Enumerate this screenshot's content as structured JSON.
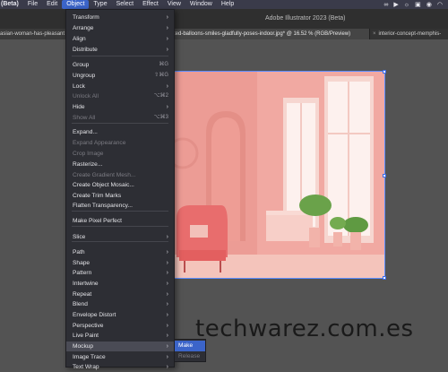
{
  "menubar": {
    "items": [
      {
        "label": "(Beta)"
      },
      {
        "label": "File"
      },
      {
        "label": "Edit"
      },
      {
        "label": "Object"
      },
      {
        "label": "Type"
      },
      {
        "label": "Select"
      },
      {
        "label": "Effect"
      },
      {
        "label": "View"
      },
      {
        "label": "Window"
      },
      {
        "label": "Help"
      }
    ],
    "status_icons": [
      "link-icon",
      "play-icon",
      "sun-icon",
      "image-icon",
      "camera-icon",
      "wifi-icon"
    ]
  },
  "window": {
    "title": "Adobe Illustrator 2023 (Beta)"
  },
  "tabs": [
    {
      "label": "asian-woman-has-pleasant"
    },
    {
      "label": "ted-balloons-smiles-gladfully-poses-indoor.jpg* @ 16.52 % (RGB/Preview)"
    },
    {
      "label": "interior-concept-memphis-"
    }
  ],
  "object_menu": {
    "items": [
      {
        "label": "Transform",
        "submenu": true
      },
      {
        "label": "Arrange",
        "submenu": true
      },
      {
        "label": "Align",
        "submenu": true
      },
      {
        "label": "Distribute",
        "submenu": true
      },
      {
        "label": "Group",
        "shortcut": "⌘G"
      },
      {
        "label": "Ungroup",
        "shortcut": "⇧⌘G"
      },
      {
        "label": "Lock",
        "submenu": true
      },
      {
        "label": "Unlock All",
        "shortcut": "⌥⌘2",
        "disabled": true
      },
      {
        "label": "Hide",
        "submenu": true
      },
      {
        "label": "Show All",
        "shortcut": "⌥⌘3",
        "disabled": true
      },
      {
        "label": "Expand..."
      },
      {
        "label": "Expand Appearance",
        "disabled": true
      },
      {
        "label": "Crop Image",
        "disabled": true
      },
      {
        "label": "Rasterize..."
      },
      {
        "label": "Create Gradient Mesh...",
        "disabled": true
      },
      {
        "label": "Create Object Mosaic..."
      },
      {
        "label": "Create Trim Marks"
      },
      {
        "label": "Flatten Transparency..."
      },
      {
        "label": "Make Pixel Perfect"
      },
      {
        "label": "Slice",
        "submenu": true
      },
      {
        "label": "Path",
        "submenu": true
      },
      {
        "label": "Shape",
        "submenu": true
      },
      {
        "label": "Pattern",
        "submenu": true
      },
      {
        "label": "Intertwine",
        "submenu": true
      },
      {
        "label": "Repeat",
        "submenu": true
      },
      {
        "label": "Blend",
        "submenu": true
      },
      {
        "label": "Envelope Distort",
        "submenu": true
      },
      {
        "label": "Perspective",
        "submenu": true
      },
      {
        "label": "Live Paint",
        "submenu": true
      },
      {
        "label": "Mockup",
        "submenu": true,
        "highlight": true
      },
      {
        "label": "Image Trace",
        "submenu": true
      },
      {
        "label": "Text Wrap",
        "submenu": true
      }
    ]
  },
  "mockup_submenu": {
    "items": [
      {
        "label": "Make",
        "active": true
      },
      {
        "label": "Release",
        "disabled": true
      }
    ]
  },
  "watermark": {
    "text": "techwarez.com.es"
  },
  "colors": {
    "accent": "#3b64c9",
    "selection": "#5a8dff",
    "menu_bg": "#2d2e34"
  }
}
